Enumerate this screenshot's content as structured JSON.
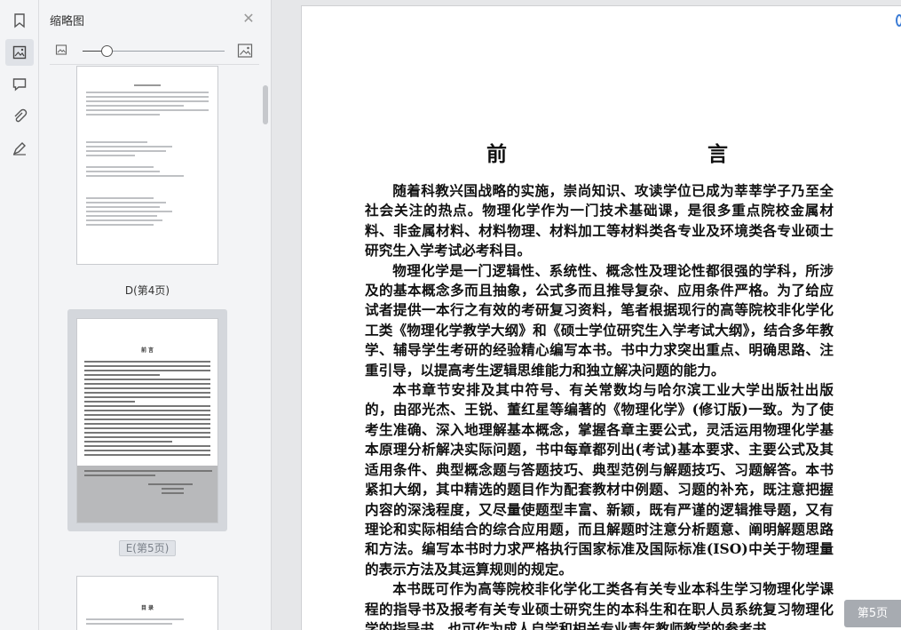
{
  "sidebar_rail": {
    "items": [
      {
        "icon": "bookmark-icon"
      },
      {
        "icon": "thumbnail-icon",
        "active": true
      },
      {
        "icon": "comment-icon"
      },
      {
        "icon": "attachment-icon"
      },
      {
        "icon": "signature-icon"
      }
    ]
  },
  "thumbnail_panel": {
    "title": "缩略图",
    "close_icon": "close-icon",
    "zoom": {
      "level": 0.17,
      "small_icon": "image-small-icon",
      "large_icon": "image-large-icon"
    },
    "thumbnails": [
      {
        "label": "D(第4页)",
        "selected": false
      },
      {
        "label": "E(第5页)",
        "selected": true,
        "heading": "前 言"
      },
      {
        "heading": "目 录",
        "selected": false
      }
    ]
  },
  "document": {
    "title": "前　　言",
    "paragraphs": [
      "随着科教兴国战略的实施，崇尚知识、攻读学位已成为莘莘学子乃至全社会关注的热点。物理化学作为一门技术基础课，是很多重点院校金属材料、非金属材料、材料物理、材料加工等材料类各专业及环境类各专业硕士研究生入学考试必考科目。",
      "物理化学是一门逻辑性、系统性、概念性及理论性都很强的学科，所涉及的基本概念多而且抽象，公式多而且推导复杂、应用条件严格。为了给应试者提供一本行之有效的考研复习资料，笔者根据现行的高等院校非化学化工类《物理化学教学大纲》和《硕士学位研究生入学考试大纲》，结合多年教学、辅导学生考研的经验精心编写本书。书中力求突出重点、明确思路、注重引导，以提高考生逻辑思维能力和独立解决问题的能力。",
      "本书章节安排及其中符号、有关常数均与哈尔滨工业大学出版社出版的，由邵光杰、王锐、董红星等编著的《物理化学》(修订版)一致。为了使考生准确、深入地理解基本概念，掌握各章主要公式，灵活运用物理化学基本原理分析解决实际问题，书中每章都列出(考试)基本要求、主要公式及其适用条件、典型概念题与答题技巧、典型范例与解题技巧、习题解答。本书紧扣大纲，其中精选的题目作为配套教材中例题、习题的补充，既注意把握内容的深浅程度，又尽量使题型丰富、新颖，既有严谨的逻辑推导题，又有理论和实际相结合的综合应用题，而且解题时注意分析题意、阐明解题思路和方法。编写本书时力求严格执行国家标准及国际标准(ISO)中关于物理量的表示方法及其运算规则的规定。",
      "本书既可作为高等院校非化学化工类各有关专业本科生学习物理化学课程的指导书及报考有关专业硕士研究生的本科生和在职人员系统复习物理化学的指导书，也可作为成人自学和相关专业青年教师教学的参考书。"
    ]
  },
  "page_indicator": "第5页",
  "colors": {
    "accent": "#3a7bd5",
    "panel_bg": "#f3f4f6",
    "selected_bg": "#d4d7dc"
  }
}
